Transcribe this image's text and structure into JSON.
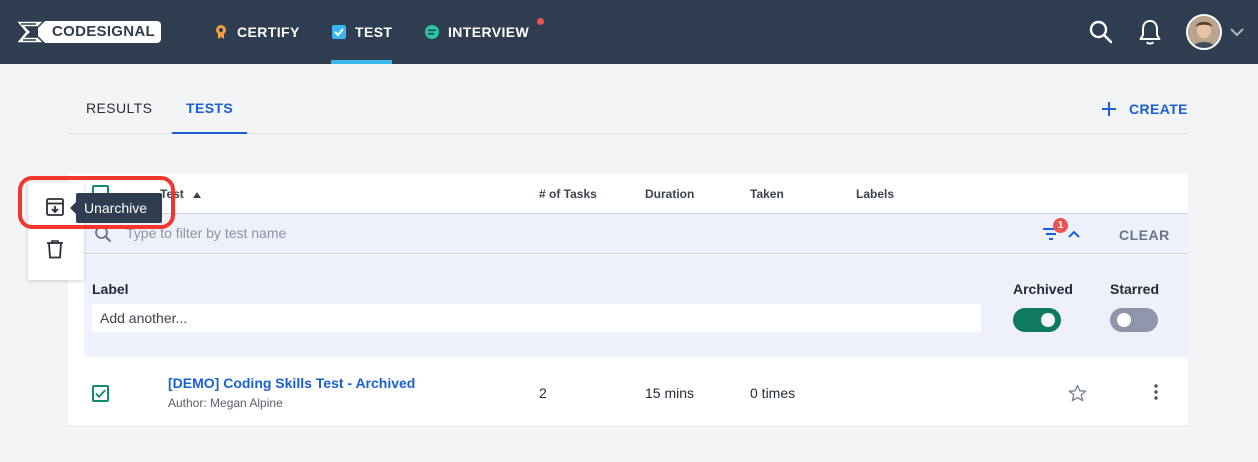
{
  "nav": {
    "brand": "CODESIGNAL",
    "items": [
      {
        "label": "CERTIFY",
        "icon": "badge-icon"
      },
      {
        "label": "TEST",
        "icon": "checkbox-icon"
      },
      {
        "label": "INTERVIEW",
        "icon": "chat-icon"
      }
    ],
    "active": "TEST",
    "colors": {
      "bar": "#2f3d51",
      "accent": "#3ab5ee"
    }
  },
  "tabs": [
    {
      "label": "RESULTS",
      "active": false
    },
    {
      "label": "TESTS",
      "active": true
    }
  ],
  "create_label": "CREATE",
  "table": {
    "headers": {
      "test": "Test",
      "tasks": "# of Tasks",
      "duration": "Duration",
      "taken": "Taken",
      "labels": "Labels"
    },
    "filter": {
      "placeholder": "Type to filter by test name",
      "badge_count": "1",
      "clear_label": "CLEAR"
    },
    "filter_panel": {
      "label_title": "Label",
      "label_placeholder": "Add another...",
      "archived_title": "Archived",
      "archived_on": true,
      "starred_title": "Starred",
      "starred_on": false
    },
    "rows": [
      {
        "title": "[DEMO] Coding Skills Test - Archived",
        "author": "Author: Megan Alpine",
        "tasks": "2",
        "duration": "15 mins",
        "taken": "0 times",
        "checked": true
      }
    ]
  },
  "action_menu": {
    "tooltip": "Unarchive",
    "items": [
      "unarchive-icon",
      "trash-icon"
    ]
  }
}
